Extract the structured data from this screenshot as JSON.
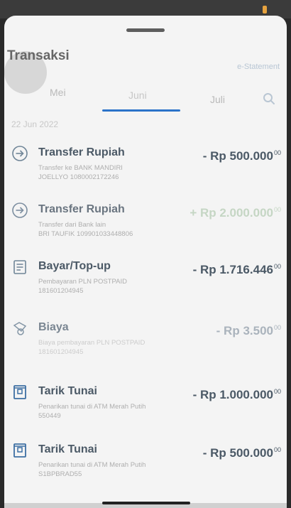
{
  "header": {
    "title": "Transaksi",
    "estatement_label": "e-Statement"
  },
  "tabs": [
    "Mei",
    "Juni",
    "Juli"
  ],
  "date_header": "22 Jun 2022",
  "transactions": [
    {
      "title": "Transfer Rupiah",
      "desc1": "Transfer ke BANK MANDIRI",
      "desc2": "JOELLYO 1080002172246",
      "amount": "- Rp 500.000",
      "cents": "00",
      "icon": "transfer-icon"
    },
    {
      "title": "Transfer Rupiah",
      "desc1": "Transfer dari Bank lain",
      "desc2": "BRI TAUFIK 109901033448806",
      "amount": "+ Rp 2.000.000",
      "cents": "00",
      "icon": "transfer-icon"
    },
    {
      "title": "Bayar/Top-up",
      "desc1": "Pembayaran PLN POSTPAID",
      "desc2": "181601204945",
      "amount": "- Rp 1.716.446",
      "cents": "00",
      "icon": "bill-icon"
    },
    {
      "title": "Biaya",
      "desc1": "Biaya pembayaran PLN POSTPAID",
      "desc2": "181601204945",
      "amount": "- Rp 3.500",
      "cents": "00",
      "icon": "fee-icon"
    },
    {
      "title": "Tarik Tunai",
      "desc1": "Penarikan tunai di ATM Merah Putih",
      "desc2": "550449",
      "amount": "- Rp 1.000.000",
      "cents": "00",
      "icon": "atm-icon"
    },
    {
      "title": "Tarik Tunai",
      "desc1": "Penarikan tunai di ATM Merah Putih",
      "desc2": "S1BPBRAD55",
      "amount": "- Rp 500.000",
      "cents": "00",
      "icon": "atm-icon"
    }
  ],
  "colors": {
    "accent": "#2b73c9",
    "text": "#4b5966",
    "muted": "#aeaeae",
    "background": "#f4f4f4"
  }
}
